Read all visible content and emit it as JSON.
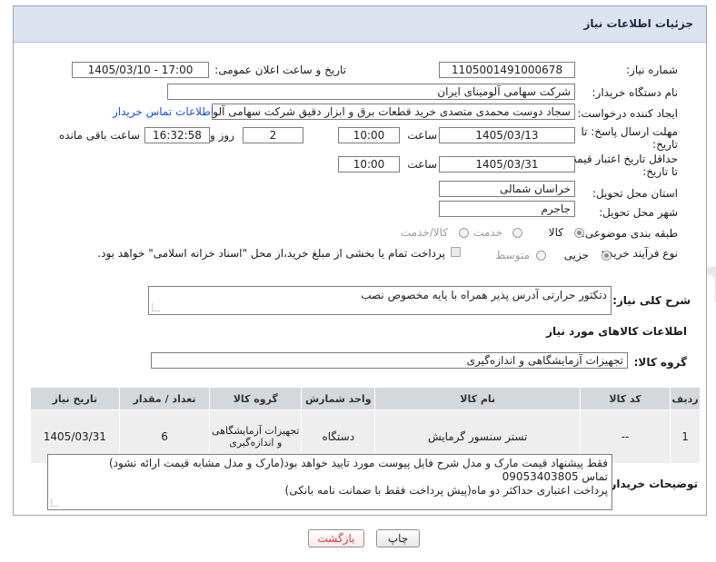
{
  "title": "جزئیات اطلاعات نیاز",
  "labels": {
    "need_number": "شماره نیاز:",
    "announce_datetime": "تاریخ و ساعت اعلان عمومی:",
    "buyer_org": "نام دستگاه خریدار:",
    "requester": "ایجاد کننده درخواست:",
    "reply_deadline_1": "مهلت ارسال پاسخ: تا",
    "reply_deadline_2": "تاریخ:",
    "price_validity_1": "حداقل تاریخ اعتبار قیمت:",
    "price_validity_2": "تا تاریخ:",
    "delivery_province": "استان محل تحویل:",
    "delivery_city": "شهر محل تحویل:",
    "category": "طبقه بندی موضوعی:",
    "process_type": "نوع فرآیند خرید :",
    "time": "ساعت",
    "day_and": "روز و",
    "remaining": "ساعت باقی مانده",
    "description": "شرح کلی نیاز:",
    "goods_info": "اطلاعات کالاهای مورد نیاز",
    "goods_group": "گروه کالا:",
    "buyer_notes": "توضیحات خریدار:"
  },
  "fields": {
    "need_number": "1105001491000678",
    "announce_datetime": "1405/03/10 - 17:00",
    "buyer_org": "شرکت سهامی آلومینای ایران",
    "requester": "سجاد دوست محمدی متصدی خرید قطعات برق و ابزار دقیق شرکت سهامی آلومینای ایران",
    "buyer_contact_link": "اطلاعات تماس خریدار",
    "reply_date": "1405/03/13",
    "reply_time": "10:00",
    "reply_days": "2",
    "reply_remaining": "16:32:58",
    "validity_date": "1405/03/31",
    "validity_time": "10:00",
    "province": "خراسان شمالی",
    "city": "جاجرم",
    "description": "دتکتور حرارتی آدرس پذیر همراه با پایه مخصوص نصب",
    "goods_group": "تجهیزات آزمایشگاهی و اندازه‌گیری",
    "buyer_notes_lines": [
      "فقط پیشنهاد قیمت مارک و مدل شرح فایل پیوست مورد تایید خواهد بود(مارک و مدل مشابه قیمت ارائه نشود)",
      "تماس 09053403805",
      "پرداخت اعتباری حداکثر دو ماه(پیش پرداخت فقط با ضمانت نامه بانکی)"
    ]
  },
  "category_options": {
    "goods": "کالا",
    "service": "خدمت",
    "goods_service": "کالا/خدمت",
    "selected": "کالا"
  },
  "process_options": {
    "partial": "جزیی",
    "medium": "متوسط",
    "selected": "جزیی",
    "treasury_note": "پرداخت تمام یا بخشی از مبلغ خرید،از محل \"اسناد خزانه اسلامی\" خواهد بود."
  },
  "table": {
    "headers": [
      "ردیف",
      "کد کالا",
      "نام کالا",
      "واحد شمارش",
      "گروه کالا",
      "تعداد / مقدار",
      "تاریخ نیاز"
    ],
    "rows": [
      {
        "row": "1",
        "code": "--",
        "name": "تستر سنسور گرمایش",
        "unit": "دستگاه",
        "group": "تجهیزات آزمایشگاهی و اندازه‌گیری",
        "qty": "6",
        "date": "1405/03/31"
      }
    ]
  },
  "buttons": {
    "print": "چاپ",
    "back": "بازگشت"
  },
  "watermark": "AriaTender.neT",
  "colors": {
    "title_bg": "#dde3ee",
    "link": "#1a4fcf",
    "back_text": "#d43c3c",
    "table_header": "#d4d7dc"
  }
}
